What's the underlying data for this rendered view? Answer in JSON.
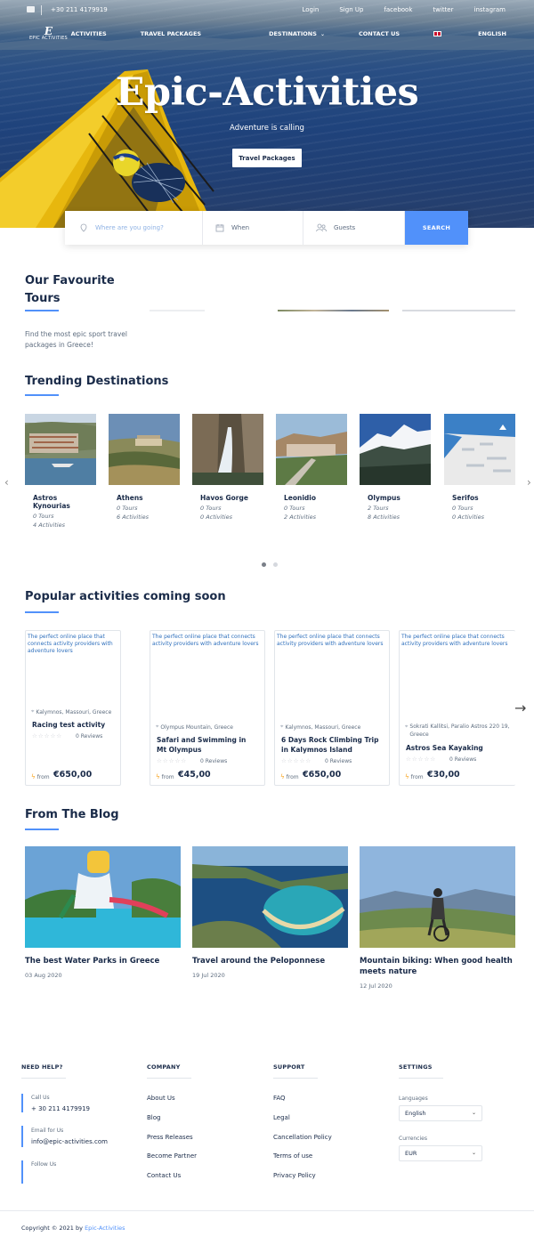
{
  "topbar": {
    "phone": "+30 211 4179919",
    "links": [
      "Login",
      "Sign Up",
      "facebook",
      "twitter",
      "instagram"
    ]
  },
  "nav": {
    "logo_text": "EPIC ACTIVITIES",
    "logo_mark": "E",
    "items": [
      "ACTIVITIES",
      "TRAVEL PACKAGES",
      "DESTINATIONS",
      "CONTACT US"
    ],
    "language": "ENGLISH"
  },
  "hero": {
    "title": "Epic-Activities",
    "subtitle": "Adventure is calling",
    "button": "Travel Packages"
  },
  "search": {
    "where_placeholder": "Where are you going?",
    "when_label": "When",
    "guests_label": "Guests",
    "button": "SEARCH"
  },
  "favourites": {
    "title_line1": "Our Favourite",
    "title_line2": "Tours",
    "description": "Find the most epic sport travel packages in Greece!"
  },
  "trending": {
    "title": "Trending Destinations",
    "items": [
      {
        "name": "Astros Kynourias",
        "tours": "0 Tours",
        "activities": "4 Activities"
      },
      {
        "name": "Athens",
        "tours": "0 Tours",
        "activities": "6 Activities"
      },
      {
        "name": "Havos Gorge",
        "tours": "0 Tours",
        "activities": "0 Activities"
      },
      {
        "name": "Leonidio",
        "tours": "0 Tours",
        "activities": "2 Activities"
      },
      {
        "name": "Olympus",
        "tours": "2 Tours",
        "activities": "8 Activities"
      },
      {
        "name": "Serifos",
        "tours": "0 Tours",
        "activities": "0 Activities"
      }
    ]
  },
  "popular": {
    "title": "Popular activities coming soon",
    "items": [
      {
        "desc": "The perfect online place that connects activity providers with adventure lovers",
        "location": "Kalymnos, Massouri, Greece",
        "title": "Racing test activity",
        "reviews": "0 Reviews",
        "from": "from",
        "price": "€650,00"
      },
      {
        "desc": "The perfect online place that connects activity providers with adventure lovers",
        "location": "Olympus Mountain, Greece",
        "title": "Safari and Swimming in Mt Olympus",
        "reviews": "0 Reviews",
        "from": "from",
        "price": "€45,00"
      },
      {
        "desc": "The perfect online place that connects activity providers with adventure lovers",
        "location": "Kalymnos, Massouri, Greece",
        "title": "6 Days Rock Climbing Trip in Kalymnos Island",
        "reviews": "0 Reviews",
        "from": "from",
        "price": "€650,00"
      },
      {
        "desc": "The perfect online place that connects activity providers with adventure lovers",
        "location": "Sokrati Kallitsi, Paralio Astros 220 19, Greece",
        "title": "Astros Sea Kayaking",
        "reviews": "0 Reviews",
        "from": "from",
        "price": "€30,00"
      }
    ]
  },
  "blog": {
    "title": "From The Blog",
    "items": [
      {
        "title": "The best Water Parks in Greece",
        "date": "03 Aug 2020"
      },
      {
        "title": "Travel around the Peloponnese",
        "date": "19 Jul 2020"
      },
      {
        "title": "Mountain biking: When good health meets nature",
        "date": "12 Jul 2020"
      }
    ]
  },
  "footer": {
    "need_help": {
      "heading": "NEED HELP?",
      "call_label": "Call Us",
      "call_value": "+ 30 211 4179919",
      "email_label": "Email for Us",
      "email_value": "info@epic-activities.com",
      "follow_label": "Follow Us"
    },
    "company": {
      "heading": "COMPANY",
      "links": [
        "About Us",
        "Blog",
        "Press Releases",
        "Become Partner",
        "Contact Us"
      ]
    },
    "support": {
      "heading": "SUPPORT",
      "links": [
        "FAQ",
        "Legal",
        "Cancellation Policy",
        "Terms of use",
        "Privacy Policy"
      ]
    },
    "settings": {
      "heading": "SETTINGS",
      "languages_label": "Languages",
      "language_value": "English",
      "currencies_label": "Currencies",
      "currency_value": "EUR"
    },
    "copyright_prefix": "Copyright © 2021 by",
    "copyright_link": "Epic-Activities"
  },
  "colors": {
    "accent": "#5191fa",
    "text": "#1a2b49",
    "muted": "#5e6d7f"
  }
}
